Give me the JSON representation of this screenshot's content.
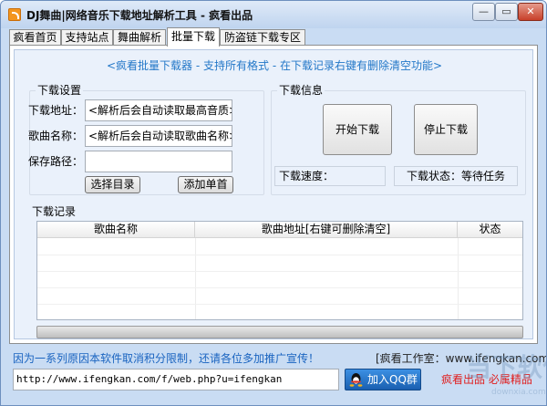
{
  "window": {
    "title": "DJ舞曲|网络音乐下载地址解析工具 - 疯看出品",
    "min_symbol": "—",
    "max_symbol": "▭",
    "close_symbol": "✕"
  },
  "tabs": [
    {
      "label": "疯看首页",
      "active": false
    },
    {
      "label": "支持站点",
      "active": false
    },
    {
      "label": "舞曲解析",
      "active": false
    },
    {
      "label": "批量下载",
      "active": true
    },
    {
      "label": "防盗链下载专区",
      "active": false
    }
  ],
  "banner": "<疯看批量下载器 - 支持所有格式 - 在下载记录右键有删除清空功能>",
  "download_settings": {
    "title": "下载设置",
    "address_label": "下载地址：",
    "address_value": "<解析后会自动读取最高音质>",
    "name_label": "歌曲名称：",
    "name_value": "<解析后会自动读取歌曲名称>",
    "path_label": "保存路径：",
    "path_value": "",
    "choose_dir": "选择目录",
    "add_single": "添加单首"
  },
  "download_info": {
    "title": "下载信息",
    "start": "开始下载",
    "stop": "停止下载",
    "speed": "下载速度：",
    "status": "下载状态：等待任务"
  },
  "records": {
    "title": "下载记录",
    "columns": [
      "歌曲名称",
      "歌曲地址[右键可删除清空]",
      "状态"
    ],
    "rows": []
  },
  "footer": {
    "notice": "因为一系列原因本软件取消积分限制，还请各位多加推广宣传！",
    "studio": "[疯看工作室：www.ifengkan.com]",
    "url": "http://www.ifengkan.com/f/web.php?u=ifengkan",
    "qq_button": "加入QQ群",
    "brand": "疯看出品 必属精品"
  },
  "watermark": {
    "big": "当下软件园",
    "small": "downxia.com"
  },
  "colors": {
    "banner": "#2478c8",
    "notice": "#1a64c0",
    "brand": "#e02020",
    "window_frame": "#c9dcf3"
  },
  "icons": {
    "app": "rss-feed-icon",
    "qq": "qq-penguin-icon"
  }
}
